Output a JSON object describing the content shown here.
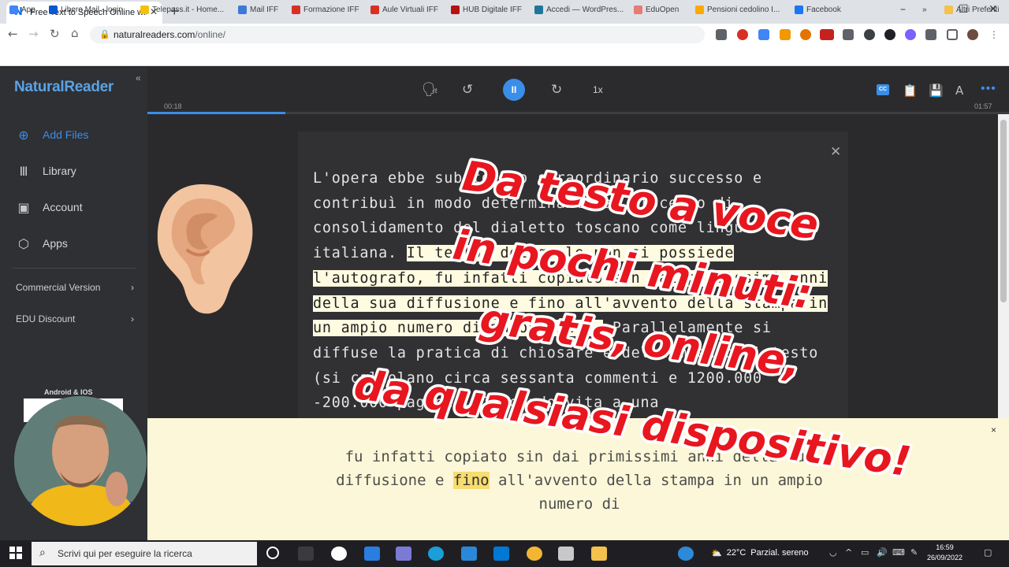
{
  "browser": {
    "tab_title": "Free Text to Speech Online with",
    "tab_favicon": "N",
    "tab_close": "✕",
    "new_tab": "+",
    "url_host": "naturalreaders.com",
    "url_path": "/online/",
    "window_controls": {
      "minimize": "–",
      "maximize": "☐",
      "close": "✕"
    },
    "nav": {
      "back": "←",
      "forward": "→",
      "reload": "↻",
      "home": "⌂"
    }
  },
  "bookmarks": [
    {
      "label": "App",
      "color": "#4285f4"
    },
    {
      "label": "Libero Mail - login",
      "color": "#0b57d0"
    },
    {
      "label": "Telepass.it - Home...",
      "color": "#f4c20d"
    },
    {
      "label": "Mail IFF",
      "color": "#3c78d8"
    },
    {
      "label": "Formazione IFF",
      "color": "#d93025"
    },
    {
      "label": "Aule Virtuali IFF",
      "color": "#d93025"
    },
    {
      "label": "HUB Digitale IFF",
      "color": "#b31412"
    },
    {
      "label": "Accedi — WordPres...",
      "color": "#21759b"
    },
    {
      "label": "EduOpen",
      "color": "#e67c73"
    },
    {
      "label": "Pensioni cedolino I...",
      "color": "#f9ab00"
    },
    {
      "label": "Facebook",
      "color": "#1877f2"
    }
  ],
  "bookmarks_more": "»",
  "bookmarks_other": "Altri Preferiti",
  "app": {
    "logo": "NaturalReader",
    "collapse": "«",
    "nav": [
      {
        "label": "Add Files",
        "icon": "⊕"
      },
      {
        "label": "Library",
        "icon": "Ⅲ"
      },
      {
        "label": "Account",
        "icon": "▣"
      },
      {
        "label": "Apps",
        "icon": "⬡"
      }
    ],
    "menus": [
      {
        "label": "Commercial Version",
        "chevron": "›"
      },
      {
        "label": "EDU Discount",
        "chevron": "›"
      }
    ],
    "android_ios": "Android & IOS",
    "player": {
      "time_current": "00:18",
      "time_total": "01:57",
      "progress": 0.16,
      "speed": "1x",
      "voice_icon": "🗣",
      "rewind_icon": "↺",
      "play_pause_icon": "II",
      "forward_icon": "↻"
    },
    "doc_close": "✕",
    "document": {
      "before": "L'opera ebbe subito uno straordinario successo e contribuì in modo determinante al processo di consolidamento del dialetto toscano come lingua italiana. ",
      "highlight": "Il testo, del quale non si possiede l'autografo, fu infatti copiato sin dai primissimi anni della sua diffusione e fino all'avvento della stampa in un ampio numero di manoscritti.",
      "after": " Parallelamente si diffuse la pratica di chiosare e del commento al testo (si calcolano circa sessanta commenti e 1200.000 -200.000 pagine),[7] dando vita a una"
    },
    "reader": {
      "close": "×",
      "before": "fu infatti copiato sin dai primissimi anni della sua diffusione e ",
      "word": "fino",
      "after": " all'avvento della stampa in un ampio numero di"
    }
  },
  "overlay_caption": {
    "lines": [
      "Da testo a voce",
      "in pochi minuti:",
      "gratis, online,",
      "da qualsiasi dispositivo!"
    ],
    "color": "#e8161f"
  },
  "taskbar": {
    "search_placeholder": "Scrivi qui per eseguire la ricerca",
    "search_icon": "⌕",
    "weather_temp": "22°C",
    "weather_text": "Parzial. sereno",
    "time": "16:59",
    "date": "26/09/2022"
  }
}
